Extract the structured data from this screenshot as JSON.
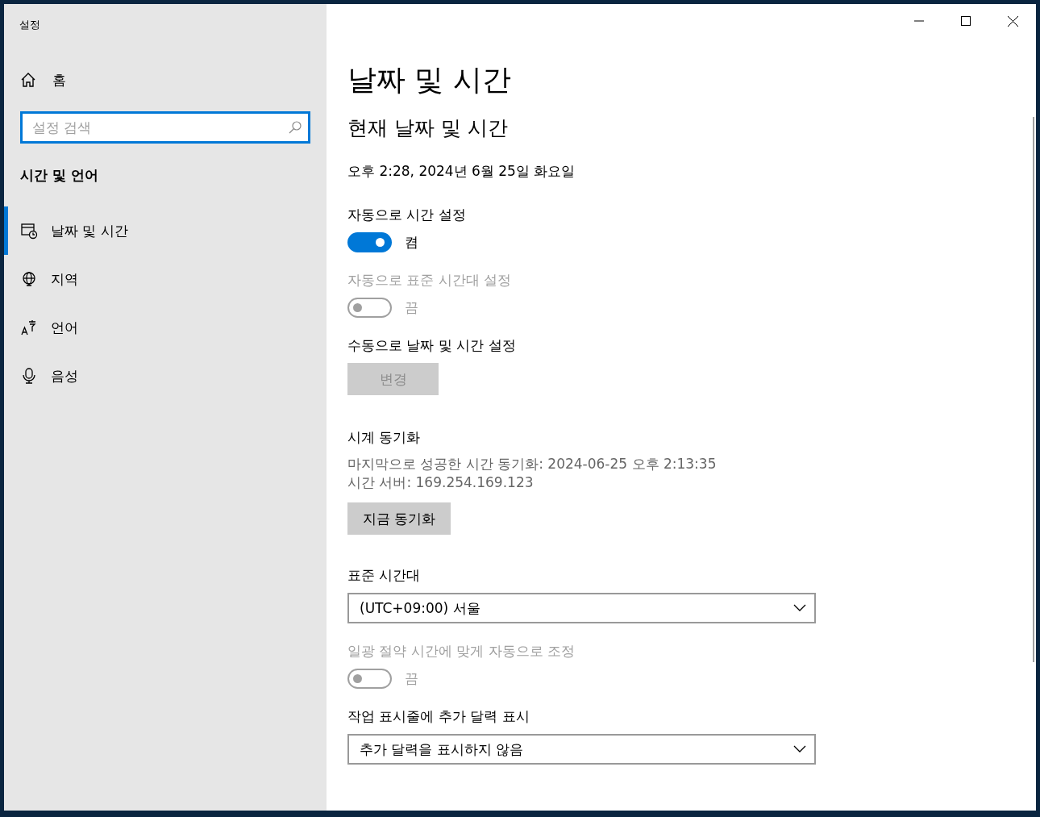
{
  "window": {
    "title": "설정"
  },
  "sidebar": {
    "home": "홈",
    "search": {
      "placeholder": "설정 검색"
    },
    "section": "시간 및 언어",
    "items": [
      {
        "label": "날짜 및 시간",
        "selected": true,
        "kind": "calendar"
      },
      {
        "label": "지역",
        "selected": false,
        "kind": "globe"
      },
      {
        "label": "언어",
        "selected": false,
        "kind": "language"
      },
      {
        "label": "음성",
        "selected": false,
        "kind": "microphone"
      }
    ]
  },
  "page": {
    "title": "날짜 및 시간",
    "subtitle": "현재 날짜 및 시간",
    "current": "오후 2:28, 2024년 6월 25일 화요일",
    "settings": [
      {
        "kind": "toggle",
        "label": "자동으로 시간 설정",
        "on": true,
        "disabled": false,
        "state": "켬"
      },
      {
        "kind": "toggle",
        "label": "자동으로 표준 시간대 설정",
        "on": false,
        "disabled": true,
        "state": "끔"
      },
      {
        "kind": "button",
        "label": "수동으로 날짜 및 시간 설정",
        "button": "변경",
        "disabled": true
      },
      {
        "kind": "info",
        "label": "시계 동기화",
        "lines": [
          "마지막으로 성공한 시간 동기화: 2024-06-25 오후 2:13:35",
          "시간 서버: 169.254.169.123"
        ],
        "button": "지금 동기화",
        "disabled": false
      },
      {
        "kind": "dropdown",
        "label": "표준 시간대",
        "value": "(UTC+09:00) 서울"
      },
      {
        "kind": "toggle",
        "label": "일광 절약 시간에 맞게 자동으로 조정",
        "on": false,
        "disabled": true,
        "state": "끔"
      },
      {
        "kind": "dropdown",
        "label": "작업 표시줄에 추가 달력 표시",
        "value": "추가 달력을 표시하지 않음"
      }
    ]
  }
}
